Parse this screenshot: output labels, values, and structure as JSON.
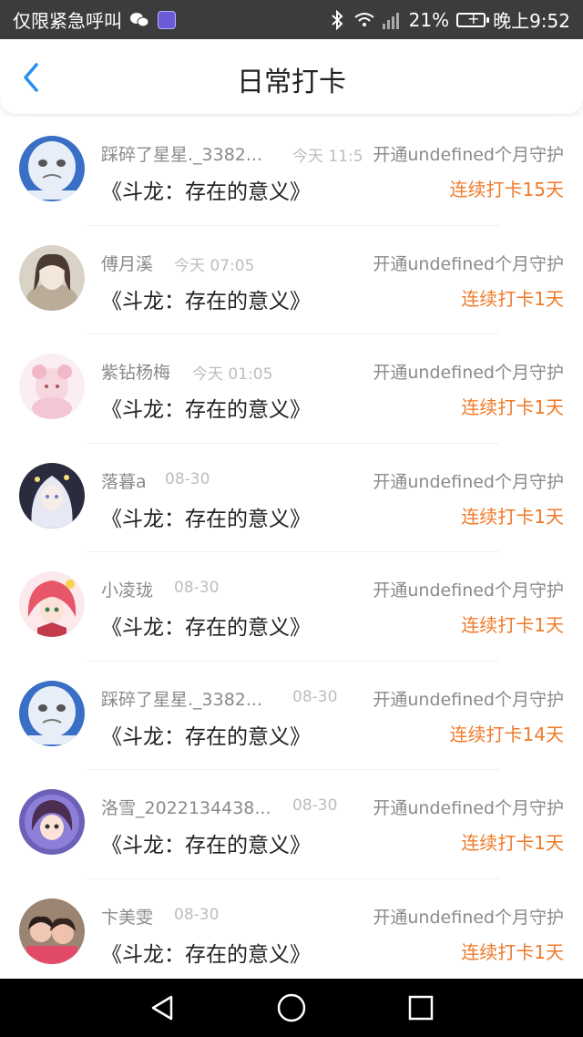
{
  "status_bar": {
    "carrier": "仅限紧急呼叫",
    "battery": "21%",
    "time": "晚上9:52",
    "icons": [
      "wechat-icon",
      "music-app-icon",
      "bluetooth-icon",
      "wifi-icon",
      "signal-icon",
      "battery-icon"
    ]
  },
  "header": {
    "title": "日常打卡",
    "back_icon": "chevron-left-icon",
    "accent_color": "#2b8ff0"
  },
  "colors": {
    "streak": "#f07a2a",
    "muted_text": "#8a8a8a",
    "time_text": "#bdbdbd"
  },
  "items": [
    {
      "name": "踩碎了星星._3382...",
      "time": "今天 11:5",
      "guard": "开通undefined个月守护",
      "book": "《斗龙：存在的意义》",
      "streak": "连续打卡15天",
      "avatar": "meme-avatar"
    },
    {
      "name": "傅月溪",
      "time": "今天 07:05",
      "guard": "开通undefined个月守护",
      "book": "《斗龙：存在的意义》",
      "streak": "连续打卡1天",
      "avatar": "anime-girl-avatar"
    },
    {
      "name": "紫钻杨梅",
      "time": "今天 01:05",
      "guard": "开通undefined个月守护",
      "book": "《斗龙：存在的意义》",
      "streak": "连续打卡1天",
      "avatar": "pink-anime-avatar"
    },
    {
      "name": "落暮a",
      "time": "08-30",
      "guard": "开通undefined个月守护",
      "book": "《斗龙：存在的意义》",
      "streak": "连续打卡1天",
      "avatar": "white-hair-avatar"
    },
    {
      "name": "小凌珑",
      "time": "08-30",
      "guard": "开通undefined个月守护",
      "book": "《斗龙：存在的意义》",
      "streak": "连续打卡1天",
      "avatar": "red-hair-avatar"
    },
    {
      "name": "踩碎了星星._3382...",
      "time": "08-30",
      "guard": "开通undefined个月守护",
      "book": "《斗龙：存在的意义》",
      "streak": "连续打卡14天",
      "avatar": "meme-avatar"
    },
    {
      "name": "洛雪_2022134438...",
      "time": "08-30",
      "guard": "开通undefined个月守护",
      "book": "《斗龙：存在的意义》",
      "streak": "连续打卡1天",
      "avatar": "purple-anime-avatar"
    },
    {
      "name": "卞美雯",
      "time": "08-30",
      "guard": "开通undefined个月守护",
      "book": "《斗龙：存在的意义》",
      "streak": "连续打卡1天",
      "avatar": "photo-avatar"
    }
  ],
  "nav_bar": {
    "icons": [
      "back-triangle-icon",
      "home-circle-icon",
      "recents-square-icon"
    ]
  }
}
